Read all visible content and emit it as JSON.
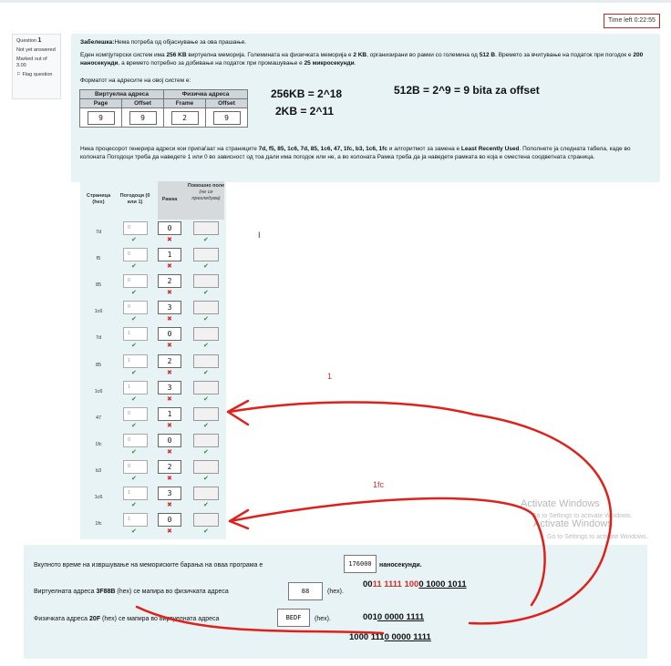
{
  "timer": "Time left 0:22:55",
  "question_info": {
    "label": "Question",
    "number": "1",
    "status": "Not yet answered",
    "marked": "Marked out of 3.00",
    "flag": "Flag question"
  },
  "note_label": "Забелешка:",
  "note_text": "Нема потреба од објаснување за ова прашање.",
  "description": [
    {
      "t": "Еден компјутерски систем има "
    },
    {
      "t": "256 KB",
      "b": true
    },
    {
      "t": " виртуелна меморија. Големината на физичката меморија е "
    },
    {
      "t": "2 KB",
      "b": true
    },
    {
      "t": ", организирани во рамки со големина од "
    },
    {
      "t": "512 B",
      "b": true
    },
    {
      "t": ". Времето за вчитување на податок при погодок е "
    },
    {
      "t": "200 наносекунди",
      "b": true
    },
    {
      "t": ", а времето потребно за добивање на податок при промашување е "
    },
    {
      "t": "25 микросекунди",
      "b": true
    },
    {
      "t": "."
    }
  ],
  "format_title": "Форматот на адресите на овој систем е:",
  "format_table": {
    "virtual": "Виртуелна адреса",
    "physical": "Физичка адреса",
    "page": "Page",
    "offset": "Offset",
    "frame": "Frame",
    "values": [
      "9",
      "9",
      "2",
      "9"
    ]
  },
  "handwritten": {
    "line1": "256KB = 2^18",
    "line2": "2KB = 2^11",
    "line3": "512B = 2^9 = 9 bita za offset"
  },
  "sequence_text": [
    {
      "t": "Нека процесорот генерира адреси кои припаѓаат на страниците "
    },
    {
      "t": "7d, f5, 85, 1c6, 7d, 85, 1c6, 47, 1fc, b3, 1c6, 1fc",
      "b": true
    },
    {
      "t": " и алгоритмот за замена е "
    },
    {
      "t": "Least Recently Used",
      "b": true
    },
    {
      "t": ". Пополнете ја следната табела, каде во колоната Погодоци треба да наведете 1 или 0 во зависност од тоа дали има погодок или не, а во колоната Рамка треба да ја наведете рамката во која е сместена соодветната страница."
    }
  ],
  "lru_headers": {
    "page": "Страница (hex)",
    "hits": "Погодоци (0 или 1)",
    "frame": "Рамка",
    "aux": "Помошно поле",
    "aux_note": "(не се прегледува)"
  },
  "lru_rows": [
    {
      "page": "7d",
      "hit": "0",
      "hit_ok": true,
      "frame": "0",
      "frame_ok": false,
      "aux_ok": true
    },
    {
      "page": "f5",
      "hit": "0",
      "hit_ok": true,
      "frame": "1",
      "frame_ok": false,
      "aux_ok": true
    },
    {
      "page": "85",
      "hit": "0",
      "hit_ok": true,
      "frame": "2",
      "frame_ok": false,
      "aux_ok": true
    },
    {
      "page": "1c6",
      "hit": "0",
      "hit_ok": true,
      "frame": "3",
      "frame_ok": false,
      "aux_ok": true
    },
    {
      "page": "7d",
      "hit": "1",
      "hit_ok": true,
      "frame": "0",
      "frame_ok": false,
      "aux_ok": true
    },
    {
      "page": "85",
      "hit": "1",
      "hit_ok": true,
      "frame": "2",
      "frame_ok": false,
      "aux_ok": true
    },
    {
      "page": "1c6",
      "hit": "1",
      "hit_ok": true,
      "frame": "3",
      "frame_ok": false,
      "aux_ok": true
    },
    {
      "page": "47",
      "hit": "0",
      "hit_ok": true,
      "frame": "1",
      "frame_ok": false,
      "aux_ok": true
    },
    {
      "page": "1fc",
      "hit": "0",
      "hit_ok": true,
      "frame": "0",
      "frame_ok": false,
      "aux_ok": true
    },
    {
      "page": "b3",
      "hit": "0",
      "hit_ok": true,
      "frame": "2",
      "frame_ok": false,
      "aux_ok": true
    },
    {
      "page": "1c6",
      "hit": "1",
      "hit_ok": true,
      "frame": "3",
      "frame_ok": false,
      "aux_ok": true
    },
    {
      "page": "1fc",
      "hit": "1",
      "hit_ok": true,
      "frame": "0",
      "frame_ok": false,
      "aux_ok": true
    }
  ],
  "annotations": {
    "label1": "1",
    "label2": "1fc"
  },
  "bottom": {
    "total_prefix": "Вкупното време на извршување на мемориските барања на оваа програма е",
    "total_value": "176000",
    "total_suffix": "наносекунди.",
    "q2_prefix": "Виртуелната адреса",
    "q2_addr": "3F88B",
    "q2_mid": "(hex) се мапира во физичката адреса",
    "q2_value": "88",
    "q2_suffix": "(hex).",
    "q3_prefix": "Физичката адреса",
    "q3_addr": "20F",
    "q3_mid": "(hex) се мапира во виртуелната адреса",
    "q3_value": "BEDF",
    "q3_suffix": "(hex).",
    "bin1_a": "00",
    "bin1_red": "11 1111 100",
    "bin1_b": "0 1000 1011",
    "bin2_a": "001",
    "bin2_b": "0 0000 1111",
    "bin3_a": "1000 111",
    "bin3_b": "0 0000 1111"
  },
  "watermark": {
    "title": "Activate Windows",
    "sub": "Go to Settings to activate Windows."
  }
}
